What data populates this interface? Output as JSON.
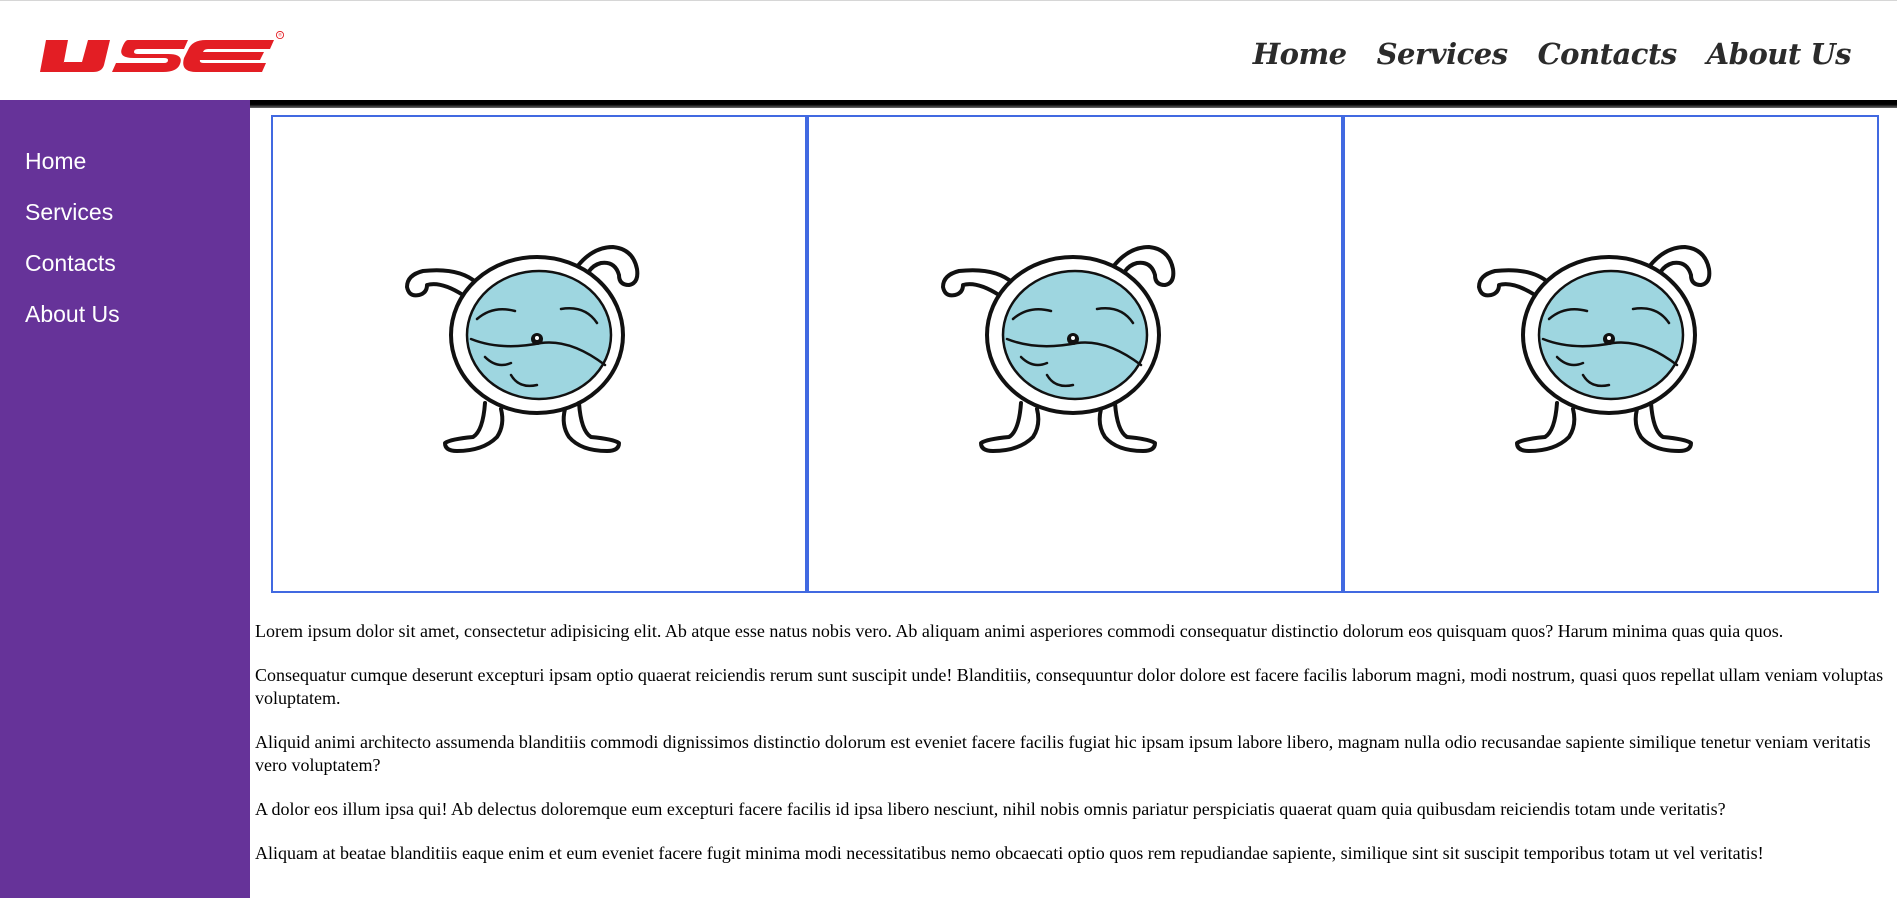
{
  "brand": {
    "logo_text": "IJSE",
    "logo_color": "#e31e24",
    "registered_mark": "®"
  },
  "top_nav": {
    "items": [
      {
        "label": "Home"
      },
      {
        "label": "Services"
      },
      {
        "label": "Contacts"
      },
      {
        "label": "About Us"
      }
    ]
  },
  "side_nav": {
    "background": "#663399",
    "items": [
      {
        "label": "Home"
      },
      {
        "label": "Services"
      },
      {
        "label": "Contacts"
      },
      {
        "label": "About Us"
      }
    ]
  },
  "gallery": {
    "border_color": "#4169e1",
    "images": [
      {
        "icon": "cartoon-creature-icon"
      },
      {
        "icon": "cartoon-creature-icon"
      },
      {
        "icon": "cartoon-creature-icon"
      }
    ]
  },
  "content": {
    "paragraphs": [
      "Lorem ipsum dolor sit amet, consectetur adipisicing elit. Ab atque esse natus nobis vero. Ab aliquam animi asperiores commodi consequatur distinctio dolorum eos quisquam quos? Harum minima quas quia quos.",
      "Consequatur cumque deserunt excepturi ipsam optio quaerat reiciendis rerum sunt suscipit unde! Blanditiis, consequuntur dolor dolore est facere facilis laborum magni, modi nostrum, quasi quos repellat ullam veniam voluptas voluptatem.",
      "Aliquid animi architecto assumenda blanditiis commodi dignissimos distinctio dolorum est eveniet facere facilis fugiat hic ipsam ipsum labore libero, magnam nulla odio recusandae sapiente similique tenetur veniam veritatis vero voluptatem?",
      "A dolor eos illum ipsa qui! Ab delectus doloremque eum excepturi facere facilis id ipsa libero nesciunt, nihil nobis omnis pariatur perspiciatis quaerat quam quia quibusdam reiciendis totam unde veritatis?",
      "Aliquam at beatae blanditiis eaque enim et eum eveniet facere fugit minima modi necessitatibus nemo obcaecati optio quos rem repudiandae sapiente, similique sint sit suscipit temporibus totam ut vel veritatis!"
    ]
  }
}
